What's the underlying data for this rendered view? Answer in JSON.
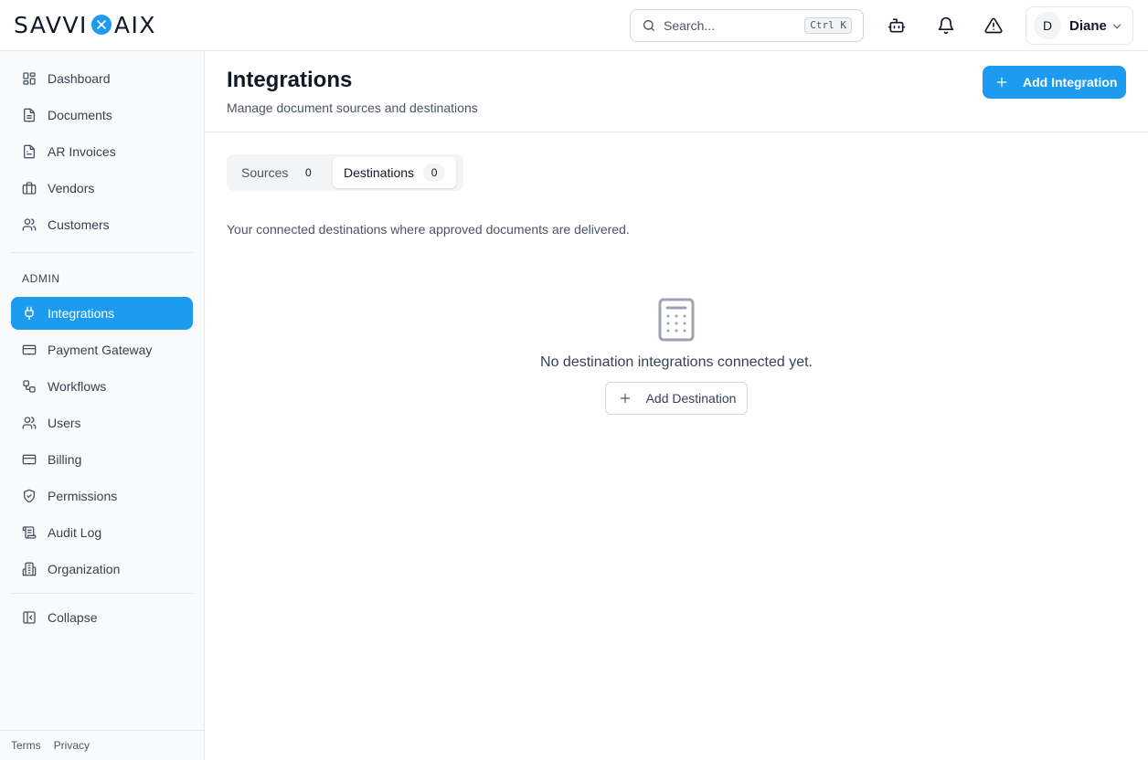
{
  "app": {
    "logo_left": "SAVVI",
    "logo_right": "AIX"
  },
  "topbar": {
    "search_placeholder": "Search...",
    "search_shortcut": "Ctrl K",
    "user": {
      "initial": "D",
      "name": "Diane"
    }
  },
  "sidebar": {
    "main_items": [
      {
        "label": "Dashboard",
        "icon": "dashboard-icon"
      },
      {
        "label": "Documents",
        "icon": "document-icon"
      },
      {
        "label": "AR Invoices",
        "icon": "invoice-icon"
      },
      {
        "label": "Vendors",
        "icon": "briefcase-icon"
      },
      {
        "label": "Customers",
        "icon": "users-icon"
      }
    ],
    "section_label": "ADMIN",
    "admin_items": [
      {
        "label": "Integrations",
        "icon": "plug-icon",
        "active": true
      },
      {
        "label": "Payment Gateway",
        "icon": "credit-card-icon"
      },
      {
        "label": "Workflows",
        "icon": "workflow-icon"
      },
      {
        "label": "Users",
        "icon": "users-icon"
      },
      {
        "label": "Billing",
        "icon": "credit-card-icon"
      },
      {
        "label": "Permissions",
        "icon": "shield-check-icon"
      },
      {
        "label": "Audit Log",
        "icon": "scroll-icon"
      },
      {
        "label": "Organization",
        "icon": "building-icon"
      }
    ],
    "collapse_label": "Collapse",
    "footer": {
      "terms": "Terms",
      "privacy": "Privacy"
    }
  },
  "page": {
    "title": "Integrations",
    "subtitle": "Manage document sources and destinations",
    "add_button": "Add Integration",
    "tabs": [
      {
        "label": "Sources",
        "count": "0",
        "active": false
      },
      {
        "label": "Destinations",
        "count": "0",
        "active": true
      }
    ],
    "description": "Your connected destinations where approved documents are delivered.",
    "empty_state": {
      "icon": "calculator-icon",
      "message": "No destination integrations connected yet.",
      "button": "Add Destination"
    }
  },
  "colors": {
    "accent": "#1d9bf0",
    "border": "#e5e7eb",
    "sidebar_bg": "#f9fafb"
  }
}
